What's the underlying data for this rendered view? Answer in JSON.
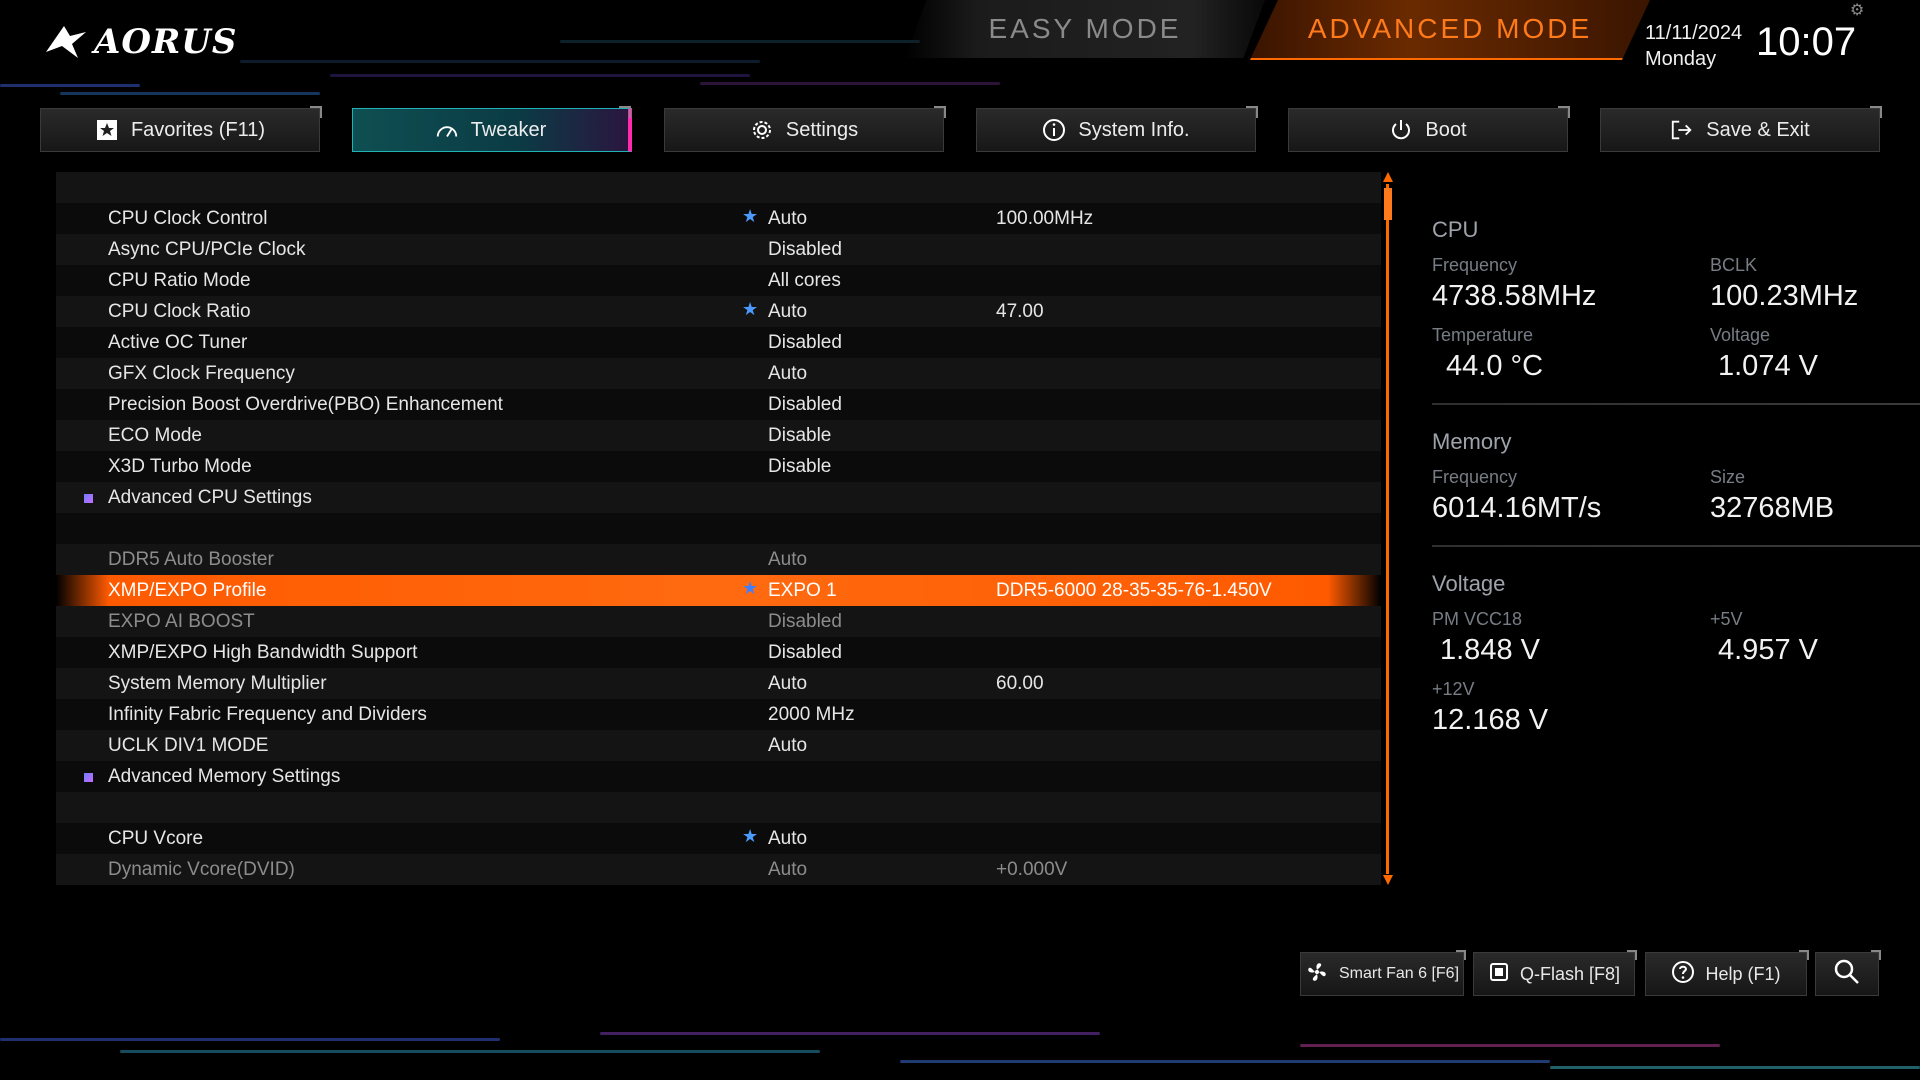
{
  "header": {
    "logo_text": "AORUS",
    "easy_mode": "EASY MODE",
    "advanced_mode": "ADVANCED MODE",
    "date": "11/11/2024",
    "weekday": "Monday",
    "time": "10:07"
  },
  "tabs": [
    {
      "label": "Favorites (F11)",
      "icon": "star-icon"
    },
    {
      "label": "Tweaker",
      "icon": "speedometer-icon",
      "active": true
    },
    {
      "label": "Settings",
      "icon": "gear-icon"
    },
    {
      "label": "System Info.",
      "icon": "info-icon"
    },
    {
      "label": "Boot",
      "icon": "power-icon"
    },
    {
      "label": "Save & Exit",
      "icon": "exit-icon"
    }
  ],
  "settings": {
    "rows": [
      {
        "label": "",
        "value": "",
        "value2": ""
      },
      {
        "label": "CPU Clock Control",
        "value": "Auto",
        "value2": "100.00MHz"
      },
      {
        "label": "Async CPU/PCIe Clock",
        "value": "Disabled",
        "value2": ""
      },
      {
        "label": "CPU Ratio Mode",
        "value": "All cores",
        "value2": ""
      },
      {
        "label": "CPU Clock Ratio",
        "value": "Auto",
        "value2": "47.00"
      },
      {
        "label": "Active OC Tuner",
        "value": "Disabled",
        "value2": ""
      },
      {
        "label": "GFX Clock Frequency",
        "value": "Auto",
        "value2": ""
      },
      {
        "label": "Precision Boost Overdrive(PBO) Enhancement",
        "value": "Disabled",
        "value2": ""
      },
      {
        "label": "ECO Mode",
        "value": "Disable",
        "value2": ""
      },
      {
        "label": "X3D Turbo Mode",
        "value": "Disable",
        "value2": ""
      },
      {
        "label": "Advanced CPU Settings",
        "value": "",
        "value2": ""
      },
      {
        "label": "",
        "value": "",
        "value2": ""
      },
      {
        "label": "DDR5 Auto Booster",
        "value": "Auto",
        "value2": ""
      },
      {
        "label": "XMP/EXPO Profile",
        "value": "EXPO 1",
        "value2": "DDR5-6000 28-35-35-76-1.450V"
      },
      {
        "label": "EXPO AI BOOST",
        "value": "Disabled",
        "value2": ""
      },
      {
        "label": "XMP/EXPO High Bandwidth Support",
        "value": "Disabled",
        "value2": ""
      },
      {
        "label": "System Memory Multiplier",
        "value": "Auto",
        "value2": "60.00"
      },
      {
        "label": "Infinity Fabric Frequency and Dividers",
        "value": "2000 MHz",
        "value2": ""
      },
      {
        "label": "UCLK DIV1 MODE",
        "value": "Auto",
        "value2": ""
      },
      {
        "label": "Advanced Memory Settings",
        "value": "",
        "value2": ""
      },
      {
        "label": "",
        "value": "",
        "value2": ""
      },
      {
        "label": "CPU Vcore",
        "value": "Auto",
        "value2": ""
      },
      {
        "label": "Dynamic Vcore(DVID)",
        "value": "Auto",
        "value2": "+0.000V"
      }
    ]
  },
  "monitor": {
    "cpu": {
      "title": "CPU",
      "frequency_label": "Frequency",
      "frequency": "4738.58MHz",
      "bclk_label": "BCLK",
      "bclk": "100.23MHz",
      "temperature_label": "Temperature",
      "temperature": "44.0 °C",
      "voltage_label": "Voltage",
      "voltage": "1.074 V"
    },
    "memory": {
      "title": "Memory",
      "frequency_label": "Frequency",
      "frequency": "6014.16MT/s",
      "size_label": "Size",
      "size": "32768MB"
    },
    "voltage": {
      "title": "Voltage",
      "pm_vcc18_label": "PM VCC18",
      "pm_vcc18": "1.848 V",
      "p5v_label": "+5V",
      "p5v": "4.957 V",
      "p12v_label": "+12V",
      "p12v": "12.168 V"
    }
  },
  "bottom": {
    "smart_fan": "Smart Fan 6 [F6]",
    "qflash": "Q-Flash [F8]",
    "help": "Help (F1)"
  },
  "colors": {
    "accent_orange": "#ff6a00",
    "active_tab_teal": "#1fb3b8",
    "active_tab_pink": "#ff2ab0",
    "star_blue": "#4b9bff"
  }
}
